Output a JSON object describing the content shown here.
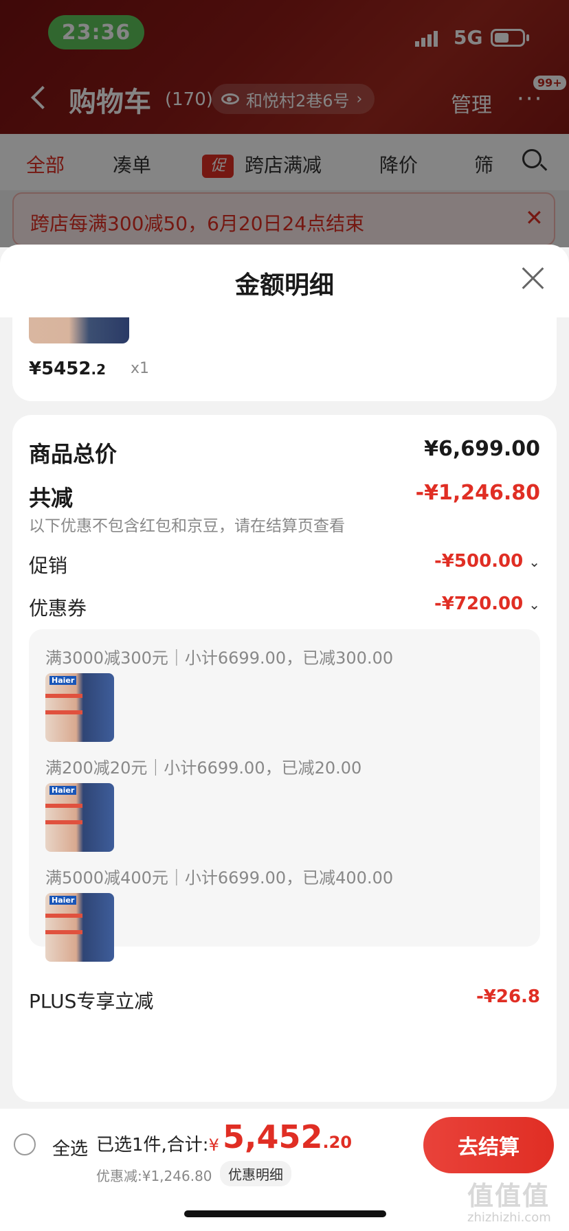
{
  "status_bar": {
    "time": "23:36",
    "network": "5G"
  },
  "nav": {
    "title": "购物车",
    "count": "(170)",
    "address": "和悦村2巷6号",
    "manage": "管理",
    "more": "···",
    "badge": "99+"
  },
  "tabs": [
    {
      "label": "全部",
      "active": true
    },
    {
      "label": "凑单"
    },
    {
      "label": "跨店满减",
      "tag": "促"
    },
    {
      "label": "降价"
    },
    {
      "label": "筛"
    }
  ],
  "promo_banner": "跨店每满300减50，6月20日24点结束",
  "sheet": {
    "title": "金额明细"
  },
  "product": {
    "price": "¥5452",
    "price_decimal": ".2",
    "qty": "x1"
  },
  "summary": {
    "total_label": "商品总价",
    "total_value": "¥6,699.00",
    "reduce_label": "共减",
    "reduce_value": "-¥1,246.80",
    "note": "以下优惠不包含红包和京豆，请在结算页查看",
    "promo_label": "促销",
    "promo_value": "-¥500.00",
    "coupon_label": "优惠券",
    "coupon_value": "-¥720.00",
    "coupons": [
      {
        "text": "满3000减300元｜小计6699.00，已减300.00"
      },
      {
        "text": "满200减20元｜小计6699.00，已减20.00"
      },
      {
        "text": "满5000减400元｜小计6699.00，已减400.00"
      }
    ],
    "plus_label": "PLUS专享立减",
    "plus_value": "-¥26.8"
  },
  "bottom_bar": {
    "select_all": "全选",
    "selected_info": "已选1件,合计:",
    "yen": "¥",
    "total_int": "5,452",
    "total_dec": ".20",
    "discount": "优惠减:¥1,246.80",
    "detail_chip": "优惠明细",
    "checkout": "去结算"
  },
  "watermark": {
    "main": "值值值",
    "sub": "zhizhizhi.com"
  },
  "colors": {
    "accent": "#e02e24",
    "header": "#8f1a17",
    "time_pill": "#5fc65b"
  },
  "icons": [
    "back-arrow-icon",
    "eye-icon",
    "search-icon",
    "close-icon",
    "chevron-down-icon",
    "radio-icon"
  ]
}
